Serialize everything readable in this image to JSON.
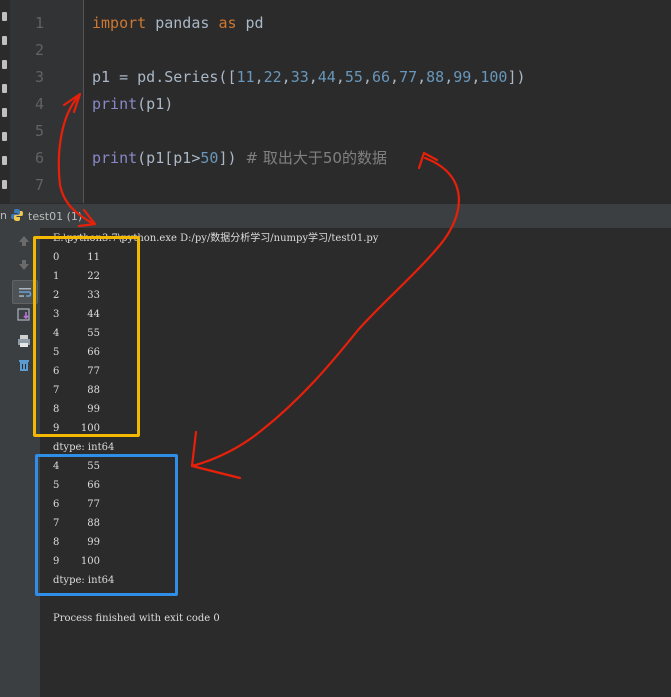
{
  "editor": {
    "line_numbers": [
      "1",
      "2",
      "3",
      "4",
      "5",
      "6",
      "7"
    ],
    "line1": {
      "kw_import": "import",
      "mod": " pandas ",
      "kw_as": "as",
      "alias": " pd"
    },
    "line3": {
      "pre": "p1 = pd.Series([",
      "n1": "11",
      "n2": "22",
      "n3": "33",
      "n4": "44",
      "n5": "55",
      "n6": "66",
      "n7": "77",
      "n8": "88",
      "n9": "99",
      "n10": "100",
      "post": "])",
      "sep": ","
    },
    "line4": {
      "fn": "print",
      "args": "(p1)"
    },
    "line6": {
      "fn": "print",
      "pre": "(p1[p1>",
      "num": "50",
      "post": "]) ",
      "comment": "# 取出大于50的数据"
    }
  },
  "run_panel": {
    "prefix": "n",
    "tab_label": "test01 (1)",
    "command": "E:\\python3.7\\python.exe D:/py/数据分析学习/numpy学习/test01.py",
    "series_all": [
      {
        "index": "0",
        "value": "11"
      },
      {
        "index": "1",
        "value": "22"
      },
      {
        "index": "2",
        "value": "33"
      },
      {
        "index": "3",
        "value": "44"
      },
      {
        "index": "4",
        "value": "55"
      },
      {
        "index": "5",
        "value": "66"
      },
      {
        "index": "6",
        "value": "77"
      },
      {
        "index": "7",
        "value": "88"
      },
      {
        "index": "8",
        "value": "99"
      },
      {
        "index": "9",
        "value": "100"
      }
    ],
    "dtype1": "dtype: int64",
    "series_filtered": [
      {
        "index": "4",
        "value": "55"
      },
      {
        "index": "5",
        "value": "66"
      },
      {
        "index": "6",
        "value": "77"
      },
      {
        "index": "7",
        "value": "88"
      },
      {
        "index": "8",
        "value": "99"
      },
      {
        "index": "9",
        "value": "100"
      }
    ],
    "dtype2": "dtype: int64",
    "exit_message": "Process finished with exit code 0"
  },
  "toolbar_icons": [
    "rerun-up-icon",
    "rerun-down-icon",
    "soft-wrap-icon",
    "scroll-to-end-icon",
    "print-icon",
    "trash-icon"
  ],
  "colors": {
    "keyword": "#cc7832",
    "number": "#6897bb",
    "builtin": "#8888c6",
    "comment": "#808080",
    "highlight_yellow": "#f5b800",
    "highlight_blue": "#2f8fe8",
    "arrow_red": "#e8200a"
  }
}
